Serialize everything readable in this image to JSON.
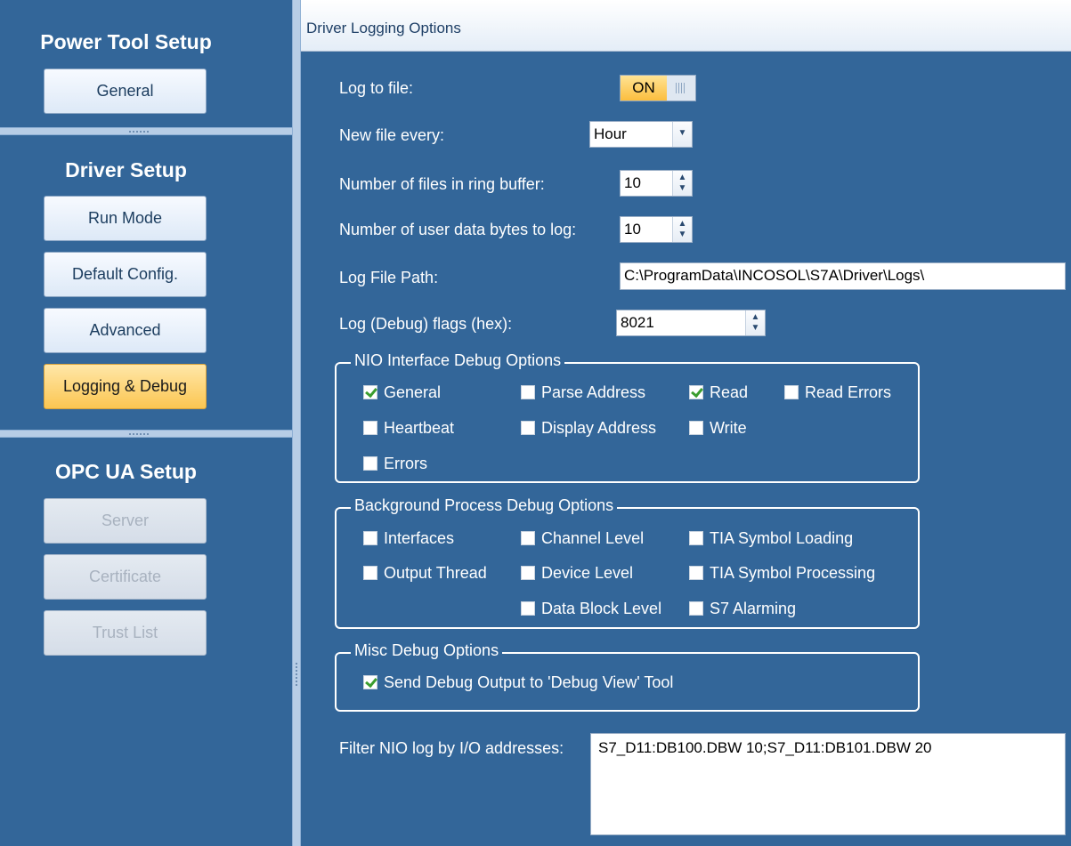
{
  "sidebar": {
    "sections": [
      {
        "title": "Power Tool Setup",
        "buttons": [
          {
            "label": "General"
          }
        ]
      },
      {
        "title": "Driver Setup",
        "buttons": [
          {
            "label": "Run Mode"
          },
          {
            "label": "Default Config."
          },
          {
            "label": "Advanced"
          },
          {
            "label": "Logging & Debug",
            "state": "active"
          }
        ]
      },
      {
        "title": "OPC UA Setup",
        "buttons": [
          {
            "label": "Server",
            "state": "disabled"
          },
          {
            "label": "Certificate",
            "state": "disabled"
          },
          {
            "label": "Trust List",
            "state": "disabled"
          }
        ]
      }
    ]
  },
  "header": {
    "title": "Driver Logging Options"
  },
  "form": {
    "log_to_file": {
      "label": "Log to file:",
      "toggle_value": "ON"
    },
    "new_file_every": {
      "label": "New file every:",
      "value": "Hour"
    },
    "ring_buffer": {
      "label": "Number of files in ring buffer:",
      "value": "10"
    },
    "user_data_bytes": {
      "label": "Number of user data bytes to log:",
      "value": "10"
    },
    "log_file_path": {
      "label": "Log File Path:",
      "value": "C:\\ProgramData\\INCOSOL\\S7A\\Driver\\Logs\\"
    },
    "debug_flags": {
      "label": "Log (Debug) flags (hex):",
      "value": "8021"
    }
  },
  "nio_group": {
    "title": "NIO Interface Debug Options",
    "options": [
      {
        "label": "General",
        "checked": true
      },
      {
        "label": "Parse Address",
        "checked": false
      },
      {
        "label": "Read",
        "checked": true
      },
      {
        "label": "Read Errors",
        "checked": false
      },
      {
        "label": "Heartbeat",
        "checked": false
      },
      {
        "label": "Display Address",
        "checked": false
      },
      {
        "label": "Write",
        "checked": false
      },
      {
        "label": "Errors",
        "checked": false
      }
    ]
  },
  "bg_group": {
    "title": "Background Process Debug Options",
    "options": [
      {
        "label": "Interfaces",
        "checked": false
      },
      {
        "label": "Channel Level",
        "checked": false
      },
      {
        "label": "TIA Symbol Loading",
        "checked": false
      },
      {
        "label": "Output Thread",
        "checked": false
      },
      {
        "label": "Device Level",
        "checked": false
      },
      {
        "label": "TIA Symbol Processing",
        "checked": false
      },
      {
        "label": "Data Block Level",
        "checked": false
      },
      {
        "label": "S7 Alarming",
        "checked": false
      }
    ]
  },
  "misc_group": {
    "title": "Misc Debug Options",
    "options": [
      {
        "label": "Send Debug Output to 'Debug View' Tool",
        "checked": true
      }
    ]
  },
  "filter": {
    "label": "Filter NIO log by I/O addresses:",
    "value": "S7_D11:DB100.DBW 10;S7_D11:DB101.DBW 20"
  },
  "colors": {
    "panel_bg": "#336699",
    "active_button": "#fbc652",
    "check_mark": "#3b9d2f"
  }
}
